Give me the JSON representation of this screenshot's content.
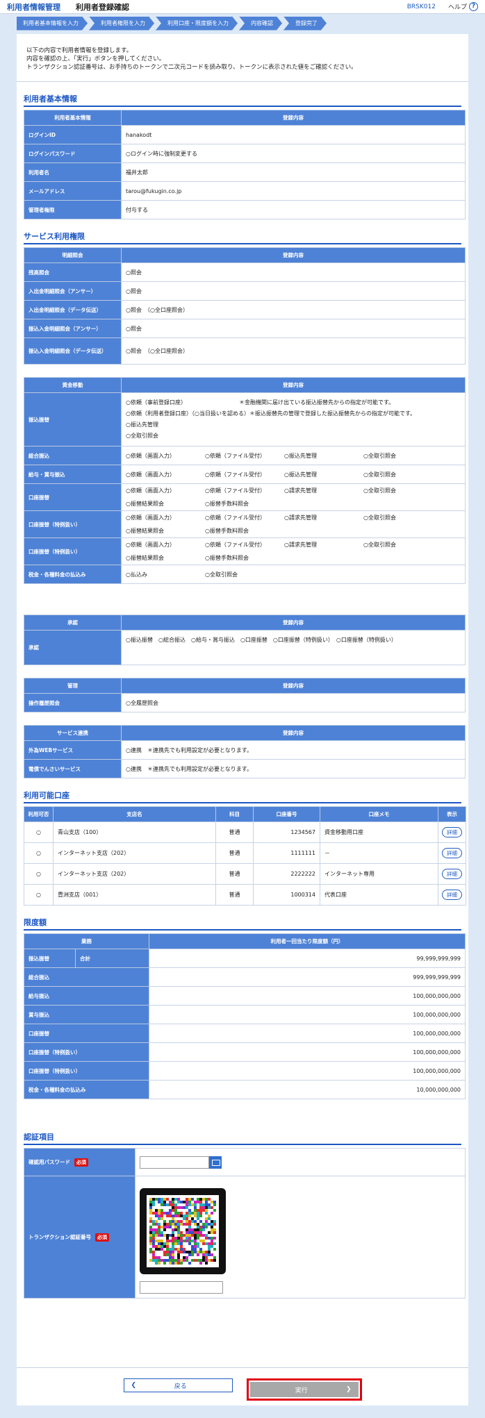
{
  "header": {
    "app_title": "利用者情報管理",
    "page_title": "利用者登録確認",
    "screen_id": "BRSK012",
    "help_label": "ヘルプ"
  },
  "steps": [
    "利用者基本情報を入力",
    "利用者権限を入力",
    "利用口座・限度額を入力",
    "内容確認",
    "登録完了"
  ],
  "intro": [
    "以下の内容で利用者情報を登録します。",
    "内容を確認の上、「実行」ボタンを押してください。",
    "トランザクション認証番号は、お手持ちのトークンで二次元コードを読み取り、トークンに表示された値をご確認ください。"
  ],
  "basic": {
    "title": "利用者基本情報",
    "col1": "利用者基本情報",
    "col2": "登録内容",
    "rows": [
      {
        "label": "ログインID",
        "value": "hanakodt"
      },
      {
        "label": "ログインパスワード",
        "value": "○ログイン時に強制変更する"
      },
      {
        "label": "利用者名",
        "value": "福井太郎"
      },
      {
        "label": "メールアドレス",
        "value": "tarou@fukugin.co.jp"
      },
      {
        "label": "管理者権限",
        "value": "付与する"
      }
    ]
  },
  "service": {
    "title": "サービス利用権限",
    "inquiry": {
      "col1": "明細照会",
      "col2": "登録内容",
      "rows": [
        {
          "label": "残高照会",
          "value": "○照会"
        },
        {
          "label": "入出金明細照会（アンサー）",
          "value": "○照会"
        },
        {
          "label": "入出金明細照会（データ伝送）",
          "value": "○照会　（○全口座照会）"
        },
        {
          "label": "振込入金明細照会（アンサー）",
          "value": "○照会"
        },
        {
          "label": "振込入金明細照会（データ伝送）",
          "value": "○照会　（○全口座照会）"
        }
      ]
    },
    "transfer": {
      "col1": "資金移動",
      "col2": "登録内容",
      "furikomi": {
        "label": "振込振替",
        "lines": [
          "○依頼（事前登録口座）　　　　　　　　　　＊金融機関に届け出ている振込振替先からの指定が可能です。",
          "○依頼（利用者登録口座）（○当日扱いを認める）＊振込振替先の管理で登録した振込振替先からの指定が可能です。",
          "○振込先管理",
          "○全取引照会"
        ]
      },
      "rows": [
        {
          "label": "総合振込",
          "items": [
            "○依頼（画面入力）",
            "○依頼（ファイル受付）",
            "○振込先管理",
            "○全取引照会"
          ]
        },
        {
          "label": "給与・賞与振込",
          "items": [
            "○依頼（画面入力）",
            "○依頼（ファイル受付）",
            "○振込先管理",
            "○全取引照会"
          ]
        },
        {
          "label": "口座振替",
          "items": [
            "○依頼（画面入力）",
            "○依頼（ファイル受付）",
            "○請求先管理",
            "○全取引照会",
            "○振替結果照会",
            "○振替手数料照会"
          ]
        },
        {
          "label": "口座振替（特例扱い）",
          "items": [
            "○依頼（画面入力）",
            "○依頼（ファイル受付）",
            "○請求先管理",
            "○全取引照会",
            "○振替結果照会",
            "○振替手数料照会"
          ]
        },
        {
          "label": "口座振替（特例扱い）",
          "items": [
            "○依頼（画面入力）",
            "○依頼（ファイル受付）",
            "○請求先管理",
            "○全取引照会",
            "○振替結果照会",
            "○振替手数料照会"
          ]
        },
        {
          "label": "税金・各種料金の払込み",
          "items": [
            "○払込み",
            "○全取引照会"
          ]
        }
      ]
    },
    "approval": {
      "col1": "承認",
      "col2": "登録内容",
      "label": "承認",
      "value": "○振込振替　○総合振込　○給与・賞与振込　○口座振替　○口座振替（特例扱い）　○口座振替（特例扱い）"
    },
    "manage": {
      "col1": "管理",
      "col2": "登録内容",
      "label": "操作履歴照会",
      "value": "○全履歴照会"
    },
    "link": {
      "col1": "サービス連携",
      "col2": "登録内容",
      "rows": [
        {
          "label": "外為WEBサービス",
          "value": "○連携　＊連携先でも利用設定が必要となります。"
        },
        {
          "label": "電債でんさいサービス",
          "value": "○連携　＊連携先でも利用設定が必要となります。"
        }
      ]
    }
  },
  "accounts": {
    "title": "利用可能口座",
    "headers": [
      "利用可否",
      "支店名",
      "科目",
      "口座番号",
      "口座メモ",
      "表示"
    ],
    "detail_label": "詳細",
    "rows": [
      {
        "use": "○",
        "branch": "青山支店（100）",
        "type": "普通",
        "number": "1234567",
        "memo": "資金移動用口座"
      },
      {
        "use": "○",
        "branch": "インターネット支店（202）",
        "type": "普通",
        "number": "1111111",
        "memo": "－"
      },
      {
        "use": "○",
        "branch": "インターネット支店（202）",
        "type": "普通",
        "number": "2222222",
        "memo": "インターネット専用"
      },
      {
        "use": "○",
        "branch": "豊洲支店（001）",
        "type": "普通",
        "number": "1000314",
        "memo": "代表口座"
      }
    ]
  },
  "limits": {
    "title": "限度額",
    "col1": "業務",
    "col2": "利用者一回当たり限度額（円）",
    "sub": "合計",
    "rows": [
      {
        "label": "振込振替",
        "value": "99,999,999,999"
      },
      {
        "label": "総合振込",
        "value": "999,999,999,999"
      },
      {
        "label": "給与振込",
        "value": "100,000,000,000"
      },
      {
        "label": "賞与振込",
        "value": "100,000,000,000"
      },
      {
        "label": "口座振替",
        "value": "100,000,000,000"
      },
      {
        "label": "口座振替（特例扱い）",
        "value": "100,000,000,000"
      },
      {
        "label": "口座振替（特例扱い）",
        "value": "100,000,000,000"
      },
      {
        "label": "税金・各種料金の払込み",
        "value": "10,000,000,000"
      }
    ]
  },
  "auth": {
    "title": "認証項目",
    "password_label": "確認用パスワード",
    "tx_label": "トランザクション認証番号",
    "required": "必須"
  },
  "buttons": {
    "back": "戻る",
    "exec": "実行"
  },
  "colors": {
    "accent": "#1a56c4",
    "header_cell": "#4e82d6",
    "highlight": "#e10010"
  }
}
